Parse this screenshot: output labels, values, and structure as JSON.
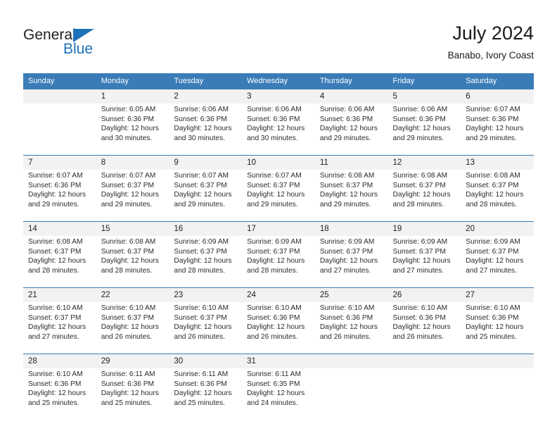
{
  "logo": {
    "word_top": "General",
    "word_bottom": "Blue",
    "accent_color": "#1e72b8",
    "triangle_icon": "triangle-icon"
  },
  "header": {
    "title": "July 2024",
    "subtitle": "Banabo, Ivory Coast"
  },
  "calendar": {
    "header_bg": "#3a7cb8",
    "daynum_bg": "#f2f2f2",
    "weekdays": [
      "Sunday",
      "Monday",
      "Tuesday",
      "Wednesday",
      "Thursday",
      "Friday",
      "Saturday"
    ],
    "weeks": [
      {
        "days": [
          {
            "number": "",
            "sunrise": "",
            "sunset": "",
            "daylight": "",
            "empty": true
          },
          {
            "number": "1",
            "sunrise": "Sunrise: 6:05 AM",
            "sunset": "Sunset: 6:36 PM",
            "daylight": "Daylight: 12 hours and 30 minutes."
          },
          {
            "number": "2",
            "sunrise": "Sunrise: 6:06 AM",
            "sunset": "Sunset: 6:36 PM",
            "daylight": "Daylight: 12 hours and 30 minutes."
          },
          {
            "number": "3",
            "sunrise": "Sunrise: 6:06 AM",
            "sunset": "Sunset: 6:36 PM",
            "daylight": "Daylight: 12 hours and 30 minutes."
          },
          {
            "number": "4",
            "sunrise": "Sunrise: 6:06 AM",
            "sunset": "Sunset: 6:36 PM",
            "daylight": "Daylight: 12 hours and 29 minutes."
          },
          {
            "number": "5",
            "sunrise": "Sunrise: 6:06 AM",
            "sunset": "Sunset: 6:36 PM",
            "daylight": "Daylight: 12 hours and 29 minutes."
          },
          {
            "number": "6",
            "sunrise": "Sunrise: 6:07 AM",
            "sunset": "Sunset: 6:36 PM",
            "daylight": "Daylight: 12 hours and 29 minutes."
          }
        ]
      },
      {
        "days": [
          {
            "number": "7",
            "sunrise": "Sunrise: 6:07 AM",
            "sunset": "Sunset: 6:36 PM",
            "daylight": "Daylight: 12 hours and 29 minutes."
          },
          {
            "number": "8",
            "sunrise": "Sunrise: 6:07 AM",
            "sunset": "Sunset: 6:37 PM",
            "daylight": "Daylight: 12 hours and 29 minutes."
          },
          {
            "number": "9",
            "sunrise": "Sunrise: 6:07 AM",
            "sunset": "Sunset: 6:37 PM",
            "daylight": "Daylight: 12 hours and 29 minutes."
          },
          {
            "number": "10",
            "sunrise": "Sunrise: 6:07 AM",
            "sunset": "Sunset: 6:37 PM",
            "daylight": "Daylight: 12 hours and 29 minutes."
          },
          {
            "number": "11",
            "sunrise": "Sunrise: 6:08 AM",
            "sunset": "Sunset: 6:37 PM",
            "daylight": "Daylight: 12 hours and 29 minutes."
          },
          {
            "number": "12",
            "sunrise": "Sunrise: 6:08 AM",
            "sunset": "Sunset: 6:37 PM",
            "daylight": "Daylight: 12 hours and 28 minutes."
          },
          {
            "number": "13",
            "sunrise": "Sunrise: 6:08 AM",
            "sunset": "Sunset: 6:37 PM",
            "daylight": "Daylight: 12 hours and 28 minutes."
          }
        ]
      },
      {
        "days": [
          {
            "number": "14",
            "sunrise": "Sunrise: 6:08 AM",
            "sunset": "Sunset: 6:37 PM",
            "daylight": "Daylight: 12 hours and 28 minutes."
          },
          {
            "number": "15",
            "sunrise": "Sunrise: 6:08 AM",
            "sunset": "Sunset: 6:37 PM",
            "daylight": "Daylight: 12 hours and 28 minutes."
          },
          {
            "number": "16",
            "sunrise": "Sunrise: 6:09 AM",
            "sunset": "Sunset: 6:37 PM",
            "daylight": "Daylight: 12 hours and 28 minutes."
          },
          {
            "number": "17",
            "sunrise": "Sunrise: 6:09 AM",
            "sunset": "Sunset: 6:37 PM",
            "daylight": "Daylight: 12 hours and 28 minutes."
          },
          {
            "number": "18",
            "sunrise": "Sunrise: 6:09 AM",
            "sunset": "Sunset: 6:37 PM",
            "daylight": "Daylight: 12 hours and 27 minutes."
          },
          {
            "number": "19",
            "sunrise": "Sunrise: 6:09 AM",
            "sunset": "Sunset: 6:37 PM",
            "daylight": "Daylight: 12 hours and 27 minutes."
          },
          {
            "number": "20",
            "sunrise": "Sunrise: 6:09 AM",
            "sunset": "Sunset: 6:37 PM",
            "daylight": "Daylight: 12 hours and 27 minutes."
          }
        ]
      },
      {
        "days": [
          {
            "number": "21",
            "sunrise": "Sunrise: 6:10 AM",
            "sunset": "Sunset: 6:37 PM",
            "daylight": "Daylight: 12 hours and 27 minutes."
          },
          {
            "number": "22",
            "sunrise": "Sunrise: 6:10 AM",
            "sunset": "Sunset: 6:37 PM",
            "daylight": "Daylight: 12 hours and 26 minutes."
          },
          {
            "number": "23",
            "sunrise": "Sunrise: 6:10 AM",
            "sunset": "Sunset: 6:37 PM",
            "daylight": "Daylight: 12 hours and 26 minutes."
          },
          {
            "number": "24",
            "sunrise": "Sunrise: 6:10 AM",
            "sunset": "Sunset: 6:36 PM",
            "daylight": "Daylight: 12 hours and 26 minutes."
          },
          {
            "number": "25",
            "sunrise": "Sunrise: 6:10 AM",
            "sunset": "Sunset: 6:36 PM",
            "daylight": "Daylight: 12 hours and 26 minutes."
          },
          {
            "number": "26",
            "sunrise": "Sunrise: 6:10 AM",
            "sunset": "Sunset: 6:36 PM",
            "daylight": "Daylight: 12 hours and 26 minutes."
          },
          {
            "number": "27",
            "sunrise": "Sunrise: 6:10 AM",
            "sunset": "Sunset: 6:36 PM",
            "daylight": "Daylight: 12 hours and 25 minutes."
          }
        ]
      },
      {
        "days": [
          {
            "number": "28",
            "sunrise": "Sunrise: 6:10 AM",
            "sunset": "Sunset: 6:36 PM",
            "daylight": "Daylight: 12 hours and 25 minutes."
          },
          {
            "number": "29",
            "sunrise": "Sunrise: 6:11 AM",
            "sunset": "Sunset: 6:36 PM",
            "daylight": "Daylight: 12 hours and 25 minutes."
          },
          {
            "number": "30",
            "sunrise": "Sunrise: 6:11 AM",
            "sunset": "Sunset: 6:36 PM",
            "daylight": "Daylight: 12 hours and 25 minutes."
          },
          {
            "number": "31",
            "sunrise": "Sunrise: 6:11 AM",
            "sunset": "Sunset: 6:35 PM",
            "daylight": "Daylight: 12 hours and 24 minutes."
          },
          {
            "number": "",
            "sunrise": "",
            "sunset": "",
            "daylight": "",
            "empty": true
          },
          {
            "number": "",
            "sunrise": "",
            "sunset": "",
            "daylight": "",
            "empty": true
          },
          {
            "number": "",
            "sunrise": "",
            "sunset": "",
            "daylight": "",
            "empty": true
          }
        ]
      }
    ]
  }
}
